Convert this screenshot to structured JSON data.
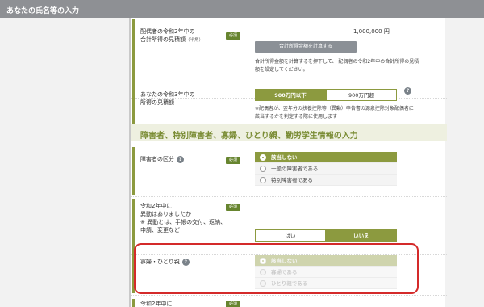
{
  "window": {
    "title": "あなたの氏名等の入力"
  },
  "rows": {
    "spouse_income": {
      "label_line1": "配偶者の令和2年中の",
      "label_line2": "合計所得の見積額",
      "label_suffix": "（半角）",
      "badge": "必須",
      "amount": "1,000,000 円",
      "calc_button": "合計所得金額を計算する",
      "note_line1": "合計所得金額を計算するを押下して、 配偶者の令和2年中の合計所得の見積",
      "note_line2": "額を設定してください。"
    },
    "r3_income": {
      "label_line1": "あなたの令和3年中の",
      "label_line2": "所得の見積額",
      "option_on": "900万円以下",
      "option_off": "900万円超",
      "help": "?",
      "note_line1": "※配偶者が、翌年分の扶養控除等（異動）申告書の源泉控除対象配偶者に",
      "note_line2": "該当するかを判定する際に使用します"
    }
  },
  "section": {
    "title": "障害者、特別障害者、寡婦、ひとり親、勤労学生情報の入力"
  },
  "disability": {
    "label": "障害者の区分",
    "help": "?",
    "badge": "必須",
    "options": [
      "該当しない",
      "一般の障害者である",
      "特別障害者である"
    ]
  },
  "change": {
    "label_line1": "令和2年中に",
    "label_line2": "異動はありましたか",
    "label_line3": "※ 異動とは、手帳の交付、返納、",
    "label_line4": "申請、変更など",
    "badge": "必須",
    "option_yes": "はい",
    "option_no": "いいえ"
  },
  "widow": {
    "label": "寡婦・ひとり親",
    "help": "?",
    "options": [
      "該当しない",
      "寡婦である",
      "ひとり親である"
    ]
  },
  "next": {
    "label": "令和2年中に",
    "badge": "必須"
  }
}
